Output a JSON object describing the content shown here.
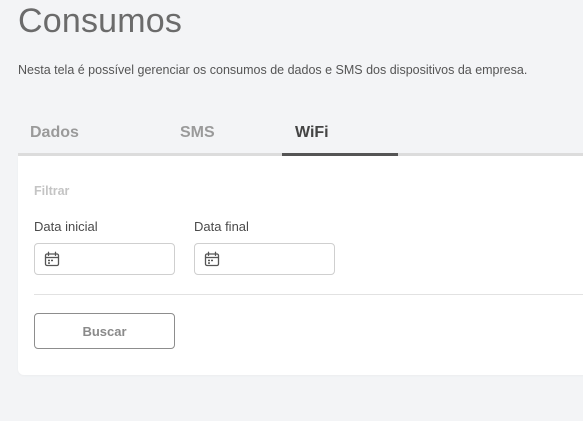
{
  "page": {
    "title": "Consumos",
    "description": "Nesta tela é possível gerenciar os consumos de dados e SMS dos dispositivos da empresa."
  },
  "tabs": [
    {
      "label": "Dados",
      "active": false
    },
    {
      "label": "SMS",
      "active": false
    },
    {
      "label": "WiFi",
      "active": true
    }
  ],
  "filter": {
    "title": "Filtrar",
    "start_date": {
      "label": "Data inicial",
      "value": "",
      "icon": "calendar-icon"
    },
    "end_date": {
      "label": "Data final",
      "value": "",
      "icon": "calendar-icon"
    },
    "search_button": "Buscar"
  },
  "colors": {
    "background": "#f3f4f6",
    "active_tab": "#444444",
    "inactive_tab": "#9a9a9a"
  }
}
